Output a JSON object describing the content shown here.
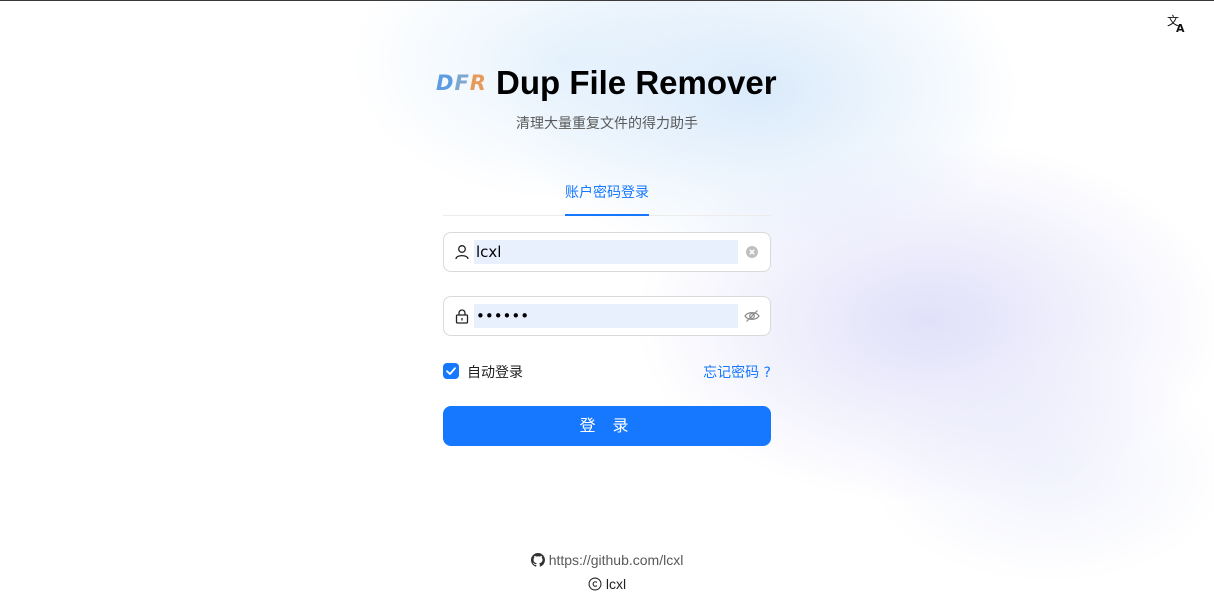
{
  "colors": {
    "primary": "#1677ff",
    "logo_blue": "#5b9de0",
    "logo_orange": "#e79b5b"
  },
  "top_right": {
    "language_icon": "translate-icon"
  },
  "header": {
    "logo": {
      "d": "D",
      "f": "F",
      "r": "R"
    },
    "title": "Dup File Remover",
    "subtitle": "清理大量重复文件的得力助手"
  },
  "tabs": [
    {
      "label": "账户密码登录",
      "active": true
    }
  ],
  "form": {
    "username": {
      "value": "lcxl",
      "prefix_icon": "user-icon",
      "suffix_icon": "clear-icon"
    },
    "password": {
      "value": "••••••",
      "prefix_icon": "lock-icon",
      "suffix_icon": "eye-invisible-icon"
    },
    "auto_login": {
      "label": "自动登录",
      "checked": true
    },
    "forgot_password": "忘记密码 ?",
    "submit_label": "登 录"
  },
  "footer": {
    "link_icon": "github-icon",
    "link_text": "https://github.com/lcxl",
    "copyright_icon": "copyright-icon",
    "copyright_text": "lcxl"
  }
}
